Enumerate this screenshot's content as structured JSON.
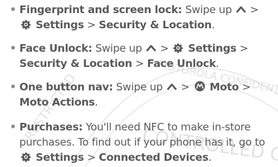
{
  "items": [
    {
      "title": "Fingerprint and screen lock:",
      "swipe": "Swipe up",
      "gt1": ">",
      "settings": "Settings",
      "gt2": ">",
      "loc": "Security & Location",
      "end": "."
    },
    {
      "title": "Face Unlock:",
      "swipe": "Swipe up",
      "gt1": ">",
      "settings": "Settings",
      "gt2": ">",
      "loc": "Security & Location",
      "gt3": ">",
      "face": "Face Unlock",
      "end": "."
    },
    {
      "title": "One button nav:",
      "swipe": "Swipe up",
      "gt1": ">",
      "moto": "Moto",
      "gt2": ">",
      "actions": "Moto Actions",
      "end": "."
    },
    {
      "title": "Purchases:",
      "text": "You'll need NFC to make in-store purchases. To find out if your phone has it, go to",
      "settings": "Settings",
      "gt": ">",
      "devices": "Connected Devices",
      "end": "."
    }
  ],
  "watermark": {
    "text1": "MOTOROLA CONFIDENTIAL",
    "text2": "CONTROLLED COPY",
    "text3": "RESTRICTED"
  }
}
